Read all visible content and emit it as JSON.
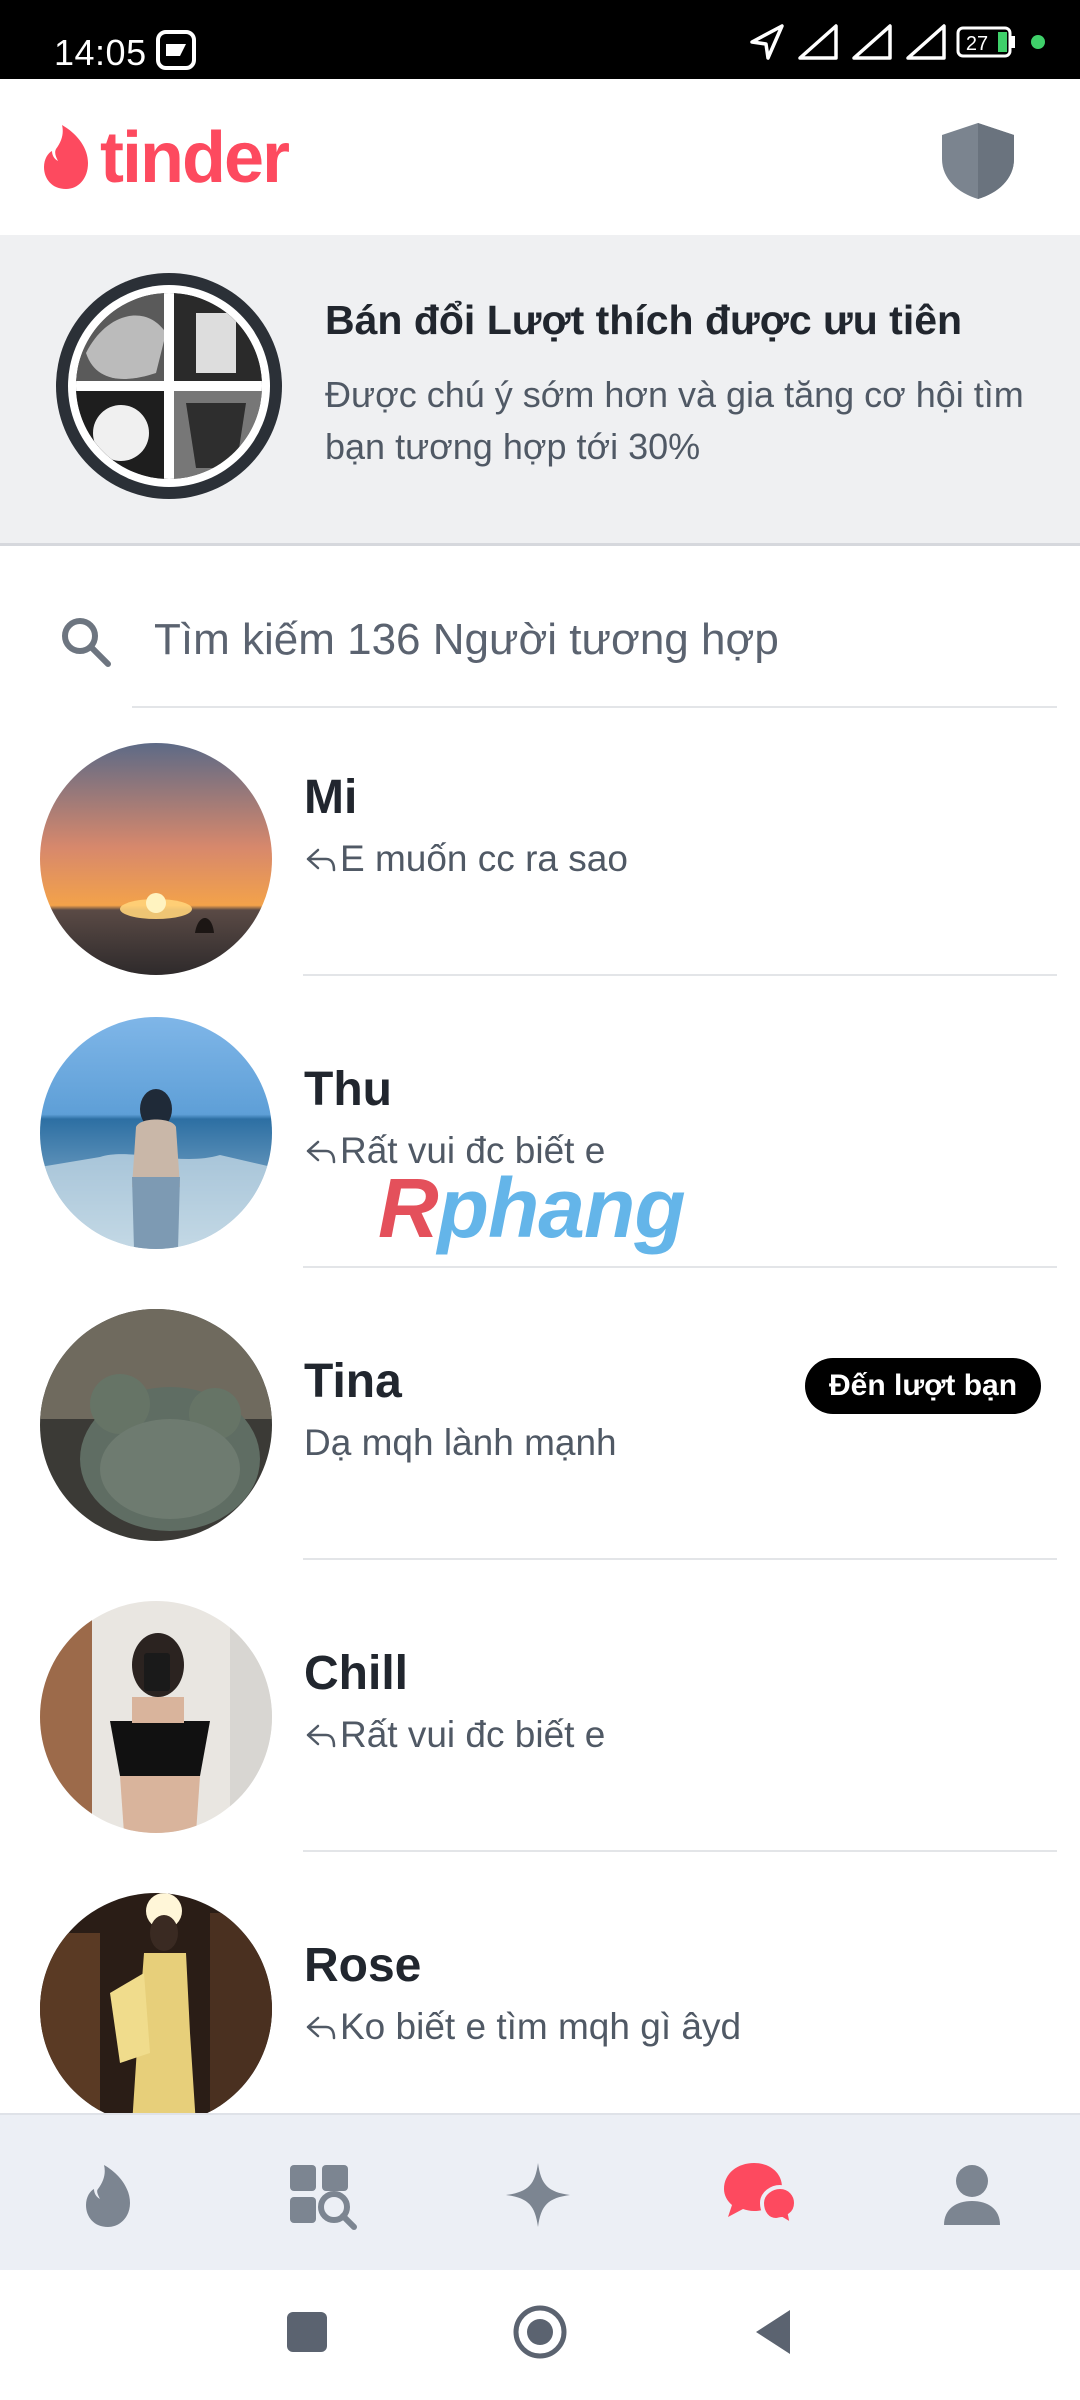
{
  "status_bar": {
    "time": "14:05",
    "battery": "27"
  },
  "header": {
    "logo_text": "tinder",
    "brand_color": "#fd4a5f"
  },
  "promo": {
    "title": "Bán đổi Lượt thích được ưu tiên",
    "description": "Được chú ý sớm hơn và gia tăng cơ hội tìm bạn tương hợp tới 30%"
  },
  "search": {
    "placeholder": "Tìm kiếm 136 Người tương hợp"
  },
  "messages": [
    {
      "name": "Mi",
      "preview": "E muốn cc ra sao",
      "replied": true,
      "badge": ""
    },
    {
      "name": "Thu",
      "preview": "Rất vui đc biết e",
      "replied": true,
      "badge": ""
    },
    {
      "name": "Tina",
      "preview": "Dạ mqh lành mạnh",
      "replied": false,
      "badge": "Đến lượt bạn"
    },
    {
      "name": "Chill",
      "preview": "Rất vui đc biết e",
      "replied": true,
      "badge": ""
    },
    {
      "name": "Rose",
      "preview": "Ko biết e tìm mqh gì âyd",
      "replied": true,
      "badge": ""
    }
  ],
  "watermark": {
    "first": "R",
    "rest": "phang"
  },
  "bottom_nav": {
    "items": [
      "flame-icon",
      "explore-icon",
      "sparkle-icon",
      "chat-icon",
      "profile-icon"
    ],
    "active": "chat-icon",
    "active_color": "#fd4a5f",
    "inactive_color": "#7c8591"
  }
}
